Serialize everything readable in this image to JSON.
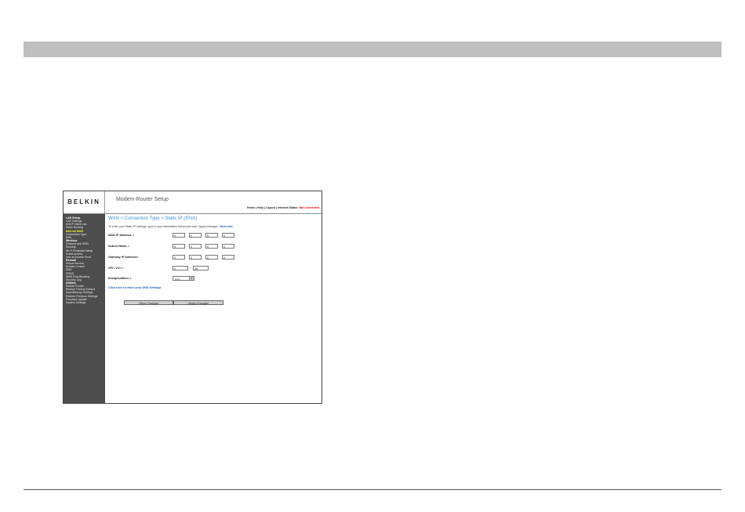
{
  "screenshot": {
    "brand": "BELKIN",
    "app_title": "Modem-Router Setup",
    "top_links": [
      "Home",
      "Help",
      "Logout",
      "Internet Status:"
    ],
    "internet_status": "Not Connected",
    "sidebar": [
      {
        "label": "LAN Setup",
        "kind": "head"
      },
      {
        "label": "LAN Settings",
        "kind": "item"
      },
      {
        "label": "DHCP Client List",
        "kind": "item"
      },
      {
        "label": "Static Routing",
        "kind": "item"
      },
      {
        "label": "Internet WAN",
        "kind": "active"
      },
      {
        "label": "Connection Type",
        "kind": "item"
      },
      {
        "label": "DNS",
        "kind": "item"
      },
      {
        "label": "Wireless",
        "kind": "head"
      },
      {
        "label": "Channel and SSID",
        "kind": "item"
      },
      {
        "label": "Security",
        "kind": "item"
      },
      {
        "label": "Wi-Fi Protected Setup",
        "kind": "item"
      },
      {
        "label": "Guest Access",
        "kind": "item"
      },
      {
        "label": "Use as Access Point",
        "kind": "item"
      },
      {
        "label": "Firewall",
        "kind": "head"
      },
      {
        "label": "Virtual Servers",
        "kind": "item"
      },
      {
        "label": "Access Control",
        "kind": "item"
      },
      {
        "label": "DMZ",
        "kind": "item"
      },
      {
        "label": "DDNS",
        "kind": "item"
      },
      {
        "label": "WAN Ping Blocking",
        "kind": "item"
      },
      {
        "label": "Security Log",
        "kind": "item"
      },
      {
        "label": "Utilities",
        "kind": "head"
      },
      {
        "label": "Restart Router",
        "kind": "item"
      },
      {
        "label": "Restore Factory Default",
        "kind": "item"
      },
      {
        "label": "Save/Backup Settings",
        "kind": "item"
      },
      {
        "label": "Restore Previous Settings",
        "kind": "item"
      },
      {
        "label": "Firmware Update",
        "kind": "item"
      },
      {
        "label": "System Settings",
        "kind": "item"
      }
    ],
    "breadcrumb": "WAN > Connection Type > Static IP (IPoA)",
    "intro": "To enter your Static IP settings, type in your information below and click \"Apply changes\".",
    "more_info": "More Info",
    "fields": {
      "wan_ip_label": "WAN IP Address >",
      "wan_ip": [
        "0",
        "0",
        "0",
        "0"
      ],
      "subnet_label": "Subnet Mask >",
      "subnet": [
        "0",
        "0",
        "0",
        "0"
      ],
      "gateway_label": "Gateway IP Address>",
      "gateway": [
        "0",
        "0",
        "0",
        "0"
      ],
      "vpi_vci_label": "VPI / VCI >",
      "vpi": "0",
      "vci": "38",
      "encap_label": "Encapsulation >",
      "encap_value": "LLC"
    },
    "dns_link": "Click here to enter your DNS Settings",
    "buttons": {
      "clear": "Clear Changes",
      "apply": "Apply Changes"
    }
  }
}
